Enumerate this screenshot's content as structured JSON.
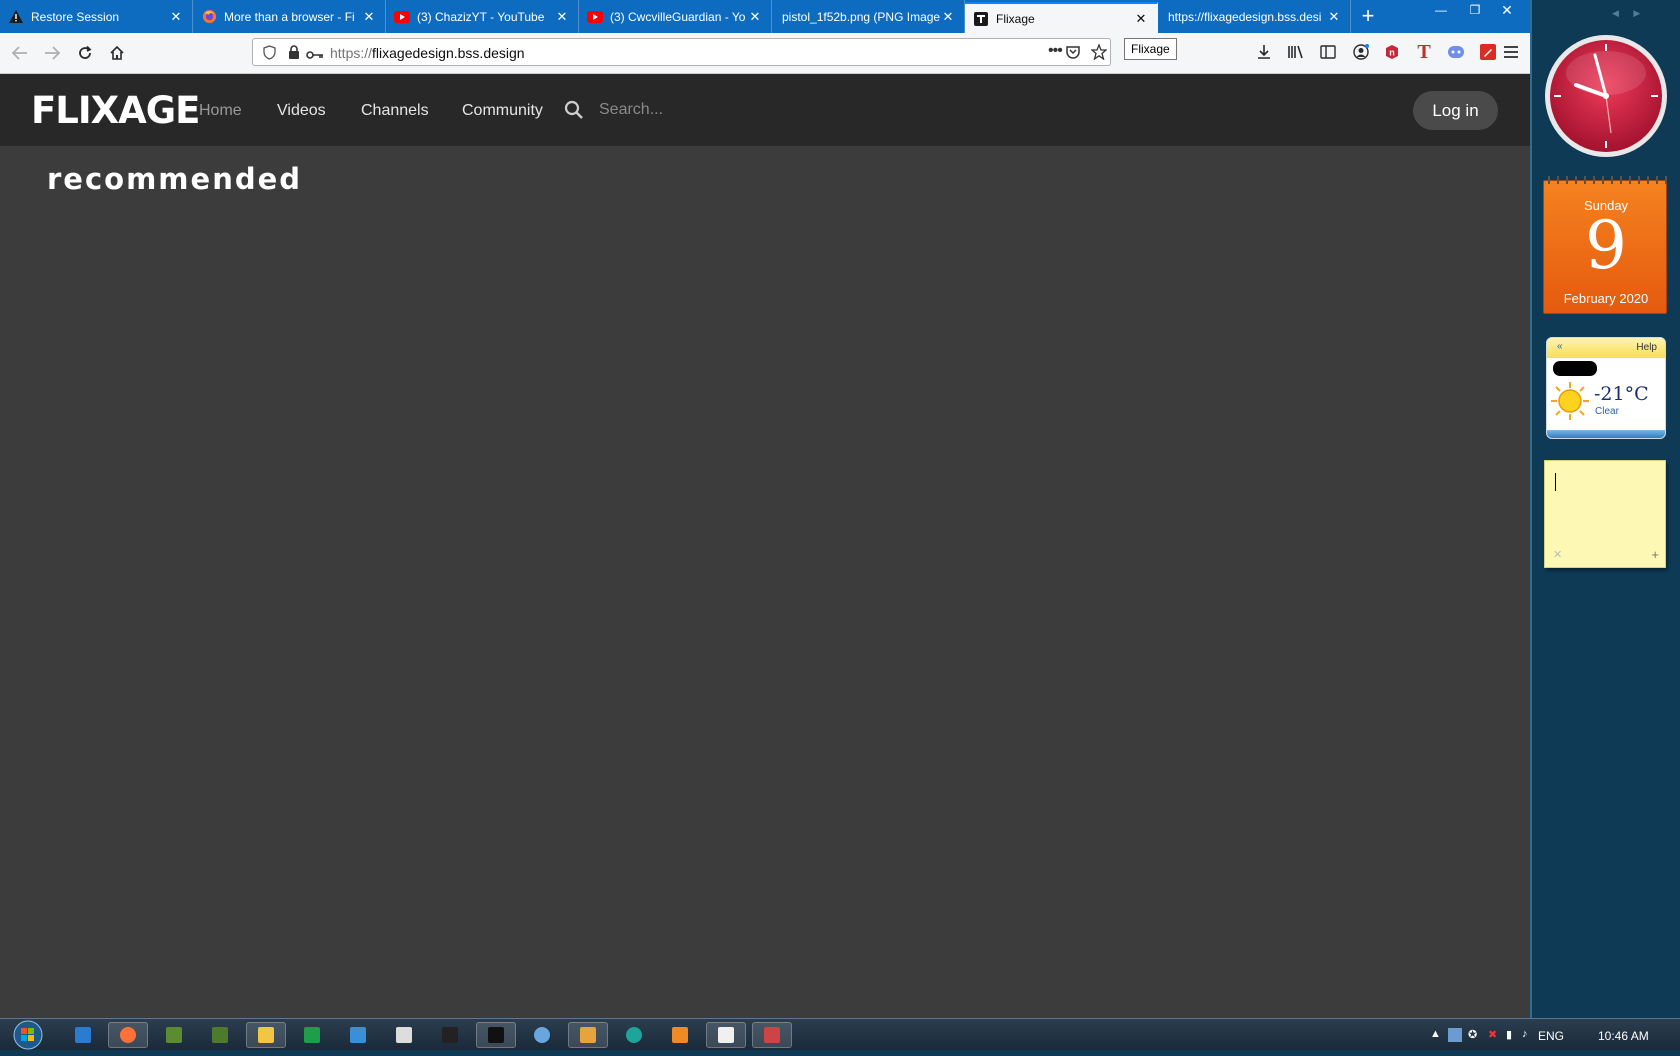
{
  "browser": {
    "tabs": [
      {
        "title": "Restore Session",
        "icon": "warning-icon",
        "active": false
      },
      {
        "title": "More than a browser - Fi",
        "icon": "firefox-icon",
        "active": false
      },
      {
        "title": "(3) ChazizYT - YouTube",
        "icon": "youtube-icon",
        "active": false
      },
      {
        "title": "(3) CwcvilleGuardian - Yo",
        "icon": "youtube-icon",
        "active": false
      },
      {
        "title": "pistol_1f52b.png (PNG Image",
        "icon": "none",
        "active": false
      },
      {
        "title": "Flixage",
        "icon": "flixage-icon",
        "active": true
      },
      {
        "title": "https://flixagedesign.bss.desi",
        "icon": "none",
        "active": false
      }
    ],
    "url_scheme": "https://",
    "url_host": "flixagedesign.bss.design",
    "tooltip": "Flixage"
  },
  "site": {
    "logo": "FLIXAGE",
    "nav": [
      "Home",
      "Videos",
      "Channels",
      "Community"
    ],
    "search_placeholder": "Search...",
    "login_label": "Log in",
    "section_title": "recommended"
  },
  "gadgets": {
    "calendar": {
      "weekday": "Sunday",
      "day": "9",
      "month_year": "February 2020"
    },
    "weather": {
      "help": "Help",
      "temperature": "-21°C",
      "condition": "Clear"
    }
  },
  "taskbar": {
    "language": "ENG",
    "time": "10:46 AM"
  },
  "colors": {
    "tab_bar": "#0d6cbf",
    "site_header": "#282828",
    "site_body": "#3c3c3c",
    "calendar_orange": "#f5821f",
    "desktop_sidebar": "#0e3a55"
  }
}
